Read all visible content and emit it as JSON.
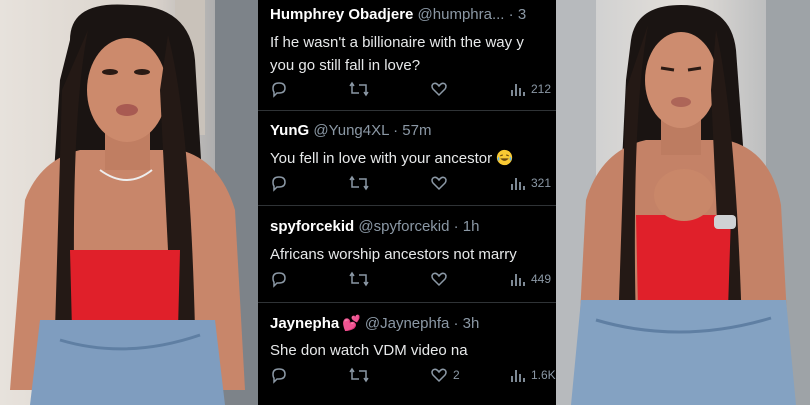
{
  "tweets": [
    {
      "name": "Humphrey Obadjere",
      "handle": "@humphra...",
      "time": "· 3",
      "text": "If he wasn't a billionaire with the way y\nyou go still fall in love?",
      "views": "212",
      "likes": ""
    },
    {
      "name": "YunG",
      "handle": "@Yung4XL",
      "time": "· 57m",
      "text": "You fell in love with your ancestor",
      "emoji": "laughing-tears-emoji",
      "views": "321",
      "likes": ""
    },
    {
      "name": "spyforcekid",
      "handle": "@spyforcekid",
      "time": "· 1h",
      "text": "Africans worship ancestors not marry",
      "views": "449",
      "likes": ""
    },
    {
      "name": "Jaynepha",
      "name_emoji": "💕",
      "handle": "@Jaynephfa",
      "time": "· 3h",
      "text": "She don watch VDM video na",
      "views": "1.6K",
      "likes": "2"
    }
  ],
  "colors": {
    "feed_bg": "#000000",
    "text": "#e7e9ea",
    "muted": "#8b98a5",
    "divider": "#2f3336"
  }
}
